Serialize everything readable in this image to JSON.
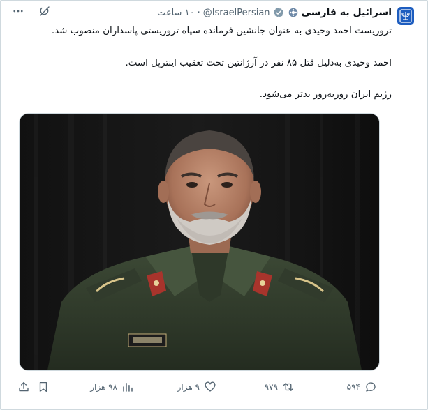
{
  "tweet": {
    "display_name": "اسرائیل به فارسی",
    "handle": "@IsraelPersian",
    "separator": "·",
    "time": "۱۰ ساعت",
    "paragraphs": [
      "تروریست احمد وحیدی به عنوان جانشین فرمانده سپاه تروریستی پاسداران منصوب شد.",
      "احمد وحیدی به‌دلیل قتل ۸۵ نفر در آرژانتین تحت تعقیب اینترپل است.",
      "رژیم ایران روزبه‌روز بدتر می‌شود."
    ],
    "media_description_icon": "photo-of-man-in-military-uniform"
  },
  "actions": {
    "reply_count": "۵۹۴",
    "retweet_count": "۹۷۹",
    "like_count": "۹ هزار",
    "views_count": "۹۸ هزار"
  },
  "colors": {
    "text_primary": "#0f1419",
    "text_secondary": "#536471",
    "border": "#cfd9de",
    "verified_badge": "#829aab",
    "avatar_bg": "#1d5dbf"
  },
  "icons": {
    "avatar": "israel-emblem-icon",
    "badge": "flower-badge-icon",
    "verified": "verified-badge-icon",
    "grok": "grok-icon",
    "more": "more-icon",
    "reply": "reply-icon",
    "retweet": "retweet-icon",
    "like": "heart-icon",
    "views": "views-chart-icon",
    "bookmark": "bookmark-icon",
    "share": "share-icon"
  }
}
